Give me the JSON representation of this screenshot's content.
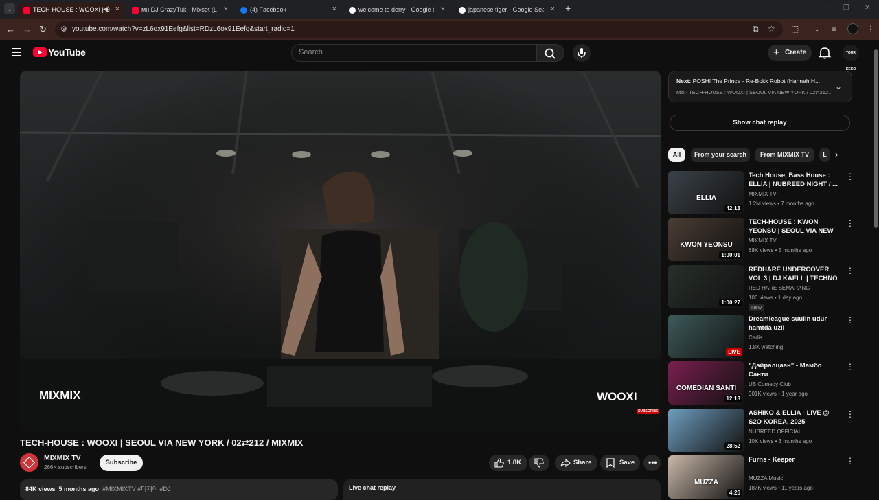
{
  "browser": {
    "tabs": [
      {
        "title": "TECH-HOUSE : WOOXI | SE",
        "favicon_color": "#ff0033",
        "active": true
      },
      {
        "title": "мн DJ CrazyTuk - Mixset (LIVE)",
        "favicon_color": "#ff0033",
        "active": false
      },
      {
        "title": "(4) Facebook",
        "favicon_color": "#1877f2",
        "active": false
      },
      {
        "title": "welcome to derry - Google Sea",
        "favicon_color": "#ffffff",
        "active": false
      },
      {
        "title": "japanese tiger - Google Search",
        "favicon_color": "#ffffff",
        "active": false
      }
    ],
    "url": "youtube.com/watch?v=zL6ox91Eefg&list=RDzL6ox91Eefg&start_radio=1"
  },
  "header": {
    "logo_text": "YouTube",
    "search_placeholder": "Search",
    "create_label": "Create",
    "avatar_text": "TOUR KEKO"
  },
  "player": {
    "watermark_left": "MIXMIX",
    "watermark_right": "WOOXI",
    "corner_badge": "SUBSCRIBE"
  },
  "video": {
    "title": "TECH-HOUSE : WOOXI | SEOUL VIA NEW YORK / 02⇄212 / MIXMIX",
    "channel_name": "MIXMIX TV",
    "subscribers": "266K subscribers",
    "subscribe_label": "Subscribe",
    "likes": "1.8K",
    "share_label": "Share",
    "save_label": "Save",
    "views": "84K views",
    "age": "5 months ago",
    "tags": "#MIXMIXTV #디제이 #DJ",
    "live_chat_label": "Live chat replay"
  },
  "sidebar": {
    "next_prefix": "Next:",
    "next_title": "POSH! The Prince - Re-Bokk Robot (Hannah H...",
    "next_sub": "Mix - TECH-HOUSE : WOOXI | SEOUL VIA NEW YORK / 02⇄212...",
    "chat_replay_label": "Show chat replay",
    "chips": [
      "All",
      "From your search",
      "From MIXMIX TV",
      "L"
    ],
    "recs": [
      {
        "title": "Tech House, Bass House : ELLIA | NUBREED NIGHT / ...",
        "channel": "MIXMIX TV",
        "meta": "1.2M views • 7 months ago",
        "duration": "42:13",
        "thumb_label": "ELLIA",
        "thumb_color": "#3a4248",
        "badge": ""
      },
      {
        "title": "TECH-HOUSE : KWON YEONSU | SEOUL VIA NEW YORK / ...",
        "channel": "MIXMIX TV",
        "meta": "68K views • 5 months ago",
        "duration": "1:00:01",
        "thumb_label": "KWON YEONSU",
        "thumb_color": "#4a3d34",
        "badge": ""
      },
      {
        "title": "REDHARE UNDERCOVER VOL 3 | DJ KAELL | TECHNO",
        "channel": "RED HARE SEMARANG",
        "meta": "106 views • 1 day ago",
        "duration": "1:00:27",
        "thumb_label": "",
        "thumb_color": "#27302a",
        "badge": "New"
      },
      {
        "title": "Dreamleague suulin udur hamtda uzii",
        "channel": "Cadis",
        "meta": "1.8K watching",
        "duration": "LIVE",
        "thumb_label": "",
        "thumb_color": "#3d5b5a",
        "badge": ""
      },
      {
        "title": "\"Дайралцаан\" - Мамбо Санти",
        "channel": "UB Comedy Club",
        "meta": "901K views • 1 year ago",
        "duration": "12:13",
        "thumb_label": "COMEDIAN SANTI",
        "thumb_color": "#7a1f4f",
        "badge": ""
      },
      {
        "title": "ASHIKO & ELLIA - LIVE  @ S2O KOREA, 2025",
        "channel": "NUBREED OFFICIAL",
        "meta": "10K views • 3 months ago",
        "duration": "28:52",
        "thumb_label": "",
        "thumb_color": "#6f9fc0",
        "badge": ""
      },
      {
        "title": "Furns - Keeper",
        "channel": "MUZZA Music",
        "meta": "187K views • 11 years ago",
        "duration": "4:26",
        "thumb_label": "MUZZA",
        "thumb_color": "#c9b8a8",
        "badge": ""
      }
    ]
  },
  "colors": {
    "accent": "#ff0033",
    "bg": "#0f0f0f",
    "live": "#cc0000"
  }
}
